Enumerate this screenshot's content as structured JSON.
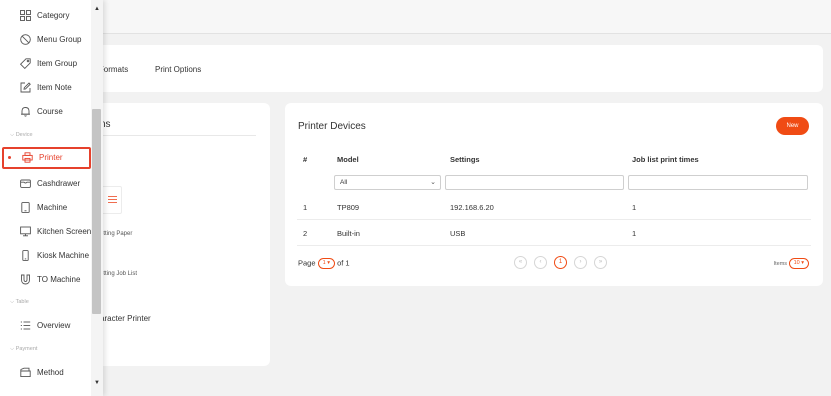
{
  "tabs": {
    "fragment_left": "nt Formats",
    "print_options": "Print Options"
  },
  "left_panel": {
    "title_fragment": "ns",
    "item1": "etting Paper",
    "item2": "etting Job List",
    "item3": "aracter Printer"
  },
  "sidebar": {
    "items": [
      {
        "label": "Category",
        "icon": "grid-icon"
      },
      {
        "label": "Menu Group",
        "icon": "no-entry-icon"
      },
      {
        "label": "Item Group",
        "icon": "tag-icon"
      },
      {
        "label": "Item Note",
        "icon": "edit-note-icon"
      },
      {
        "label": "Course",
        "icon": "bell-icon"
      }
    ],
    "section_device": "Device",
    "device_items": [
      {
        "label": "Printer",
        "icon": "printer-icon"
      },
      {
        "label": "Cashdrawer",
        "icon": "cashdrawer-icon"
      },
      {
        "label": "Machine",
        "icon": "tablet-icon"
      },
      {
        "label": "Kitchen Screen",
        "icon": "monitor-icon"
      },
      {
        "label": "Kiosk Machine",
        "icon": "phone-icon"
      },
      {
        "label": "TO Machine",
        "icon": "magnet-icon"
      }
    ],
    "section_table": "Table",
    "table_items": [
      {
        "label": "Overview",
        "icon": "list-icon"
      }
    ],
    "section_payment": "Payment",
    "payment_items": [
      {
        "label": "Method",
        "icon": "wallet-icon"
      }
    ]
  },
  "printer_devices": {
    "title": "Printer Devices",
    "new_label": "New",
    "columns": [
      "#",
      "Model",
      "Settings",
      "Job list print times"
    ],
    "filter_model": "All",
    "rows": [
      {
        "num": "1",
        "model": "TP809",
        "settings": "192.168.6.20",
        "times": "1"
      },
      {
        "num": "2",
        "model": "Built-in",
        "settings": "USB",
        "times": "1"
      }
    ],
    "pager": {
      "page_label": "Page",
      "page_value": "1",
      "of_label": "of 1",
      "current": "1",
      "items_label": "Items",
      "items_value": "10"
    }
  },
  "colors": {
    "accent": "#f04b14",
    "active_border": "#e6412c"
  }
}
